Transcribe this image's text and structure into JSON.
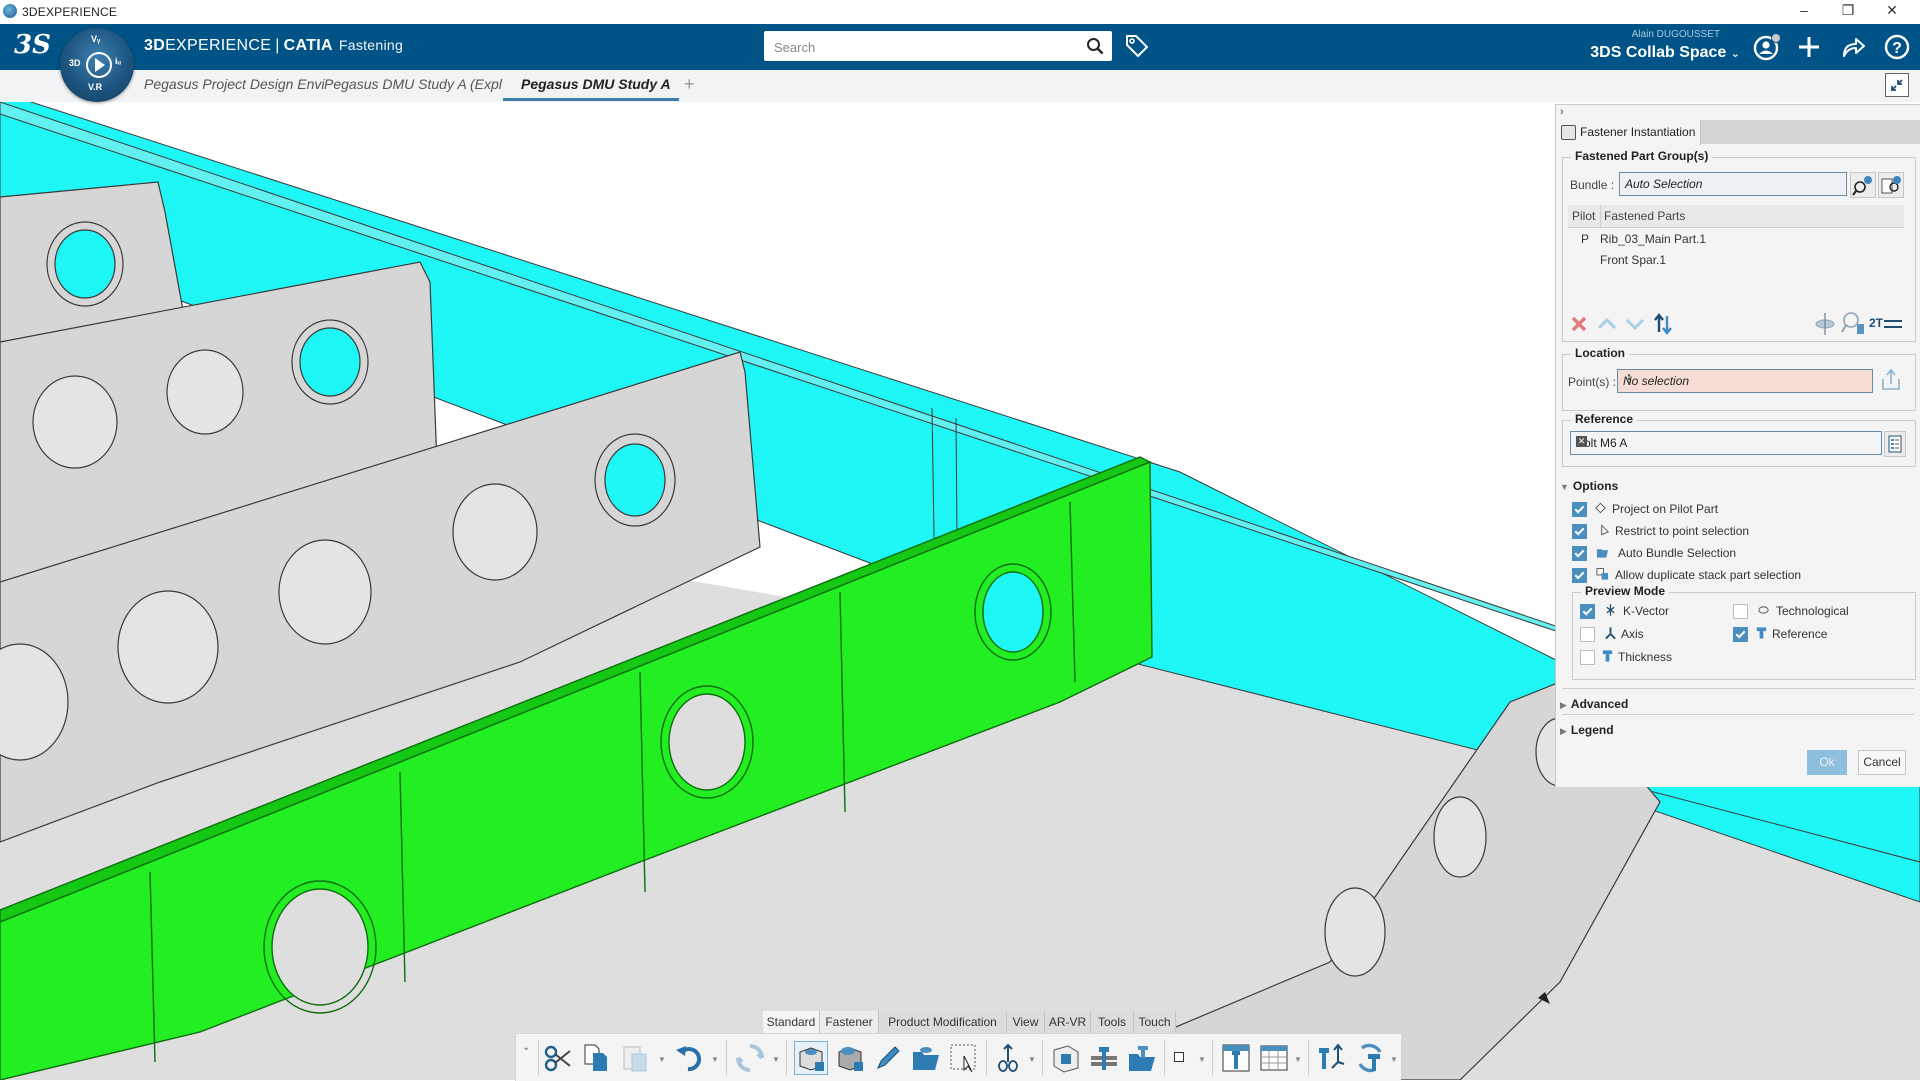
{
  "window": {
    "title": "3DEXPERIENCE",
    "controls": [
      "minimize",
      "restore",
      "close"
    ]
  },
  "header": {
    "brand_bold": "3D",
    "brand_rest": "EXPERIENCE",
    "separator": "|",
    "product": "CATIA",
    "module": "Fastening",
    "compass_labels": {
      "top": "Vᵧ",
      "left": "3D",
      "right": "iᵤ",
      "bottom": "V.R"
    },
    "search_placeholder": "Search",
    "search_value": "",
    "user_name": "Alain DUGOUSSET",
    "collab_space": "3DS Collab Space",
    "icons": [
      "tag-icon",
      "user-profile-icon",
      "add-icon",
      "share-icon",
      "help-icon"
    ]
  },
  "tabs": {
    "items": [
      {
        "label": "Pegasus Project Design Envi",
        "active": false
      },
      {
        "label": "Pegasus DMU Study A (Expl",
        "active": false
      },
      {
        "label": "Pegasus DMU Study A",
        "active": true
      }
    ],
    "add_label": "+"
  },
  "viewport": {
    "colors": {
      "background": "#ffffff",
      "spar_cyan": "#1ff6f6",
      "spar_cyan_edge": "#63f0f0",
      "selected_rib_green": "#22ee22",
      "selected_rib_dark": "#14c814",
      "rib_grey": "#d6d6d6",
      "floor_grey": "#dedede",
      "outline": "#3a3a3a"
    }
  },
  "panel": {
    "tab_title": "Fastener Instantiation",
    "fastened_group": {
      "title": "Fastened Part Group(s)",
      "bundle_label": "Bundle :",
      "bundle_value": "Auto Selection",
      "table_headers": [
        "Pilot",
        "Fastened Parts"
      ],
      "rows": [
        {
          "pilot": "P",
          "part": "Rib_03_Main Part.1"
        },
        {
          "pilot": "",
          "part": "Front Spar.1"
        }
      ],
      "row_actions": [
        "remove-icon",
        "move-up-icon",
        "move-down-icon",
        "reorder-icon"
      ],
      "right_actions": [
        "stack-thickness-icon",
        "search-fastener-icon"
      ],
      "two_t_label": "2T"
    },
    "location": {
      "title": "Location",
      "points_label": "Point(s) :",
      "points_value": "No selection"
    },
    "reference": {
      "title": "Reference",
      "value": "Bolt M6 A"
    },
    "options": {
      "title": "Options",
      "expanded": true,
      "items": [
        {
          "label": "Project on Pilot Part",
          "checked": true
        },
        {
          "label": "Restrict to point selection",
          "checked": true
        },
        {
          "label": "Auto Bundle Selection",
          "checked": true
        },
        {
          "label": "Allow duplicate stack part selection",
          "checked": true
        }
      ],
      "preview_mode": {
        "title": "Preview Mode",
        "items": [
          {
            "label": "K-Vector",
            "checked": true
          },
          {
            "label": "Technological",
            "checked": false
          },
          {
            "label": "Axis",
            "checked": false
          },
          {
            "label": "Reference",
            "checked": true
          },
          {
            "label": "Thickness",
            "checked": false
          }
        ]
      }
    },
    "advanced": {
      "title": "Advanced",
      "expanded": false
    },
    "legend": {
      "title": "Legend",
      "expanded": false
    },
    "ok_label": "Ok",
    "cancel_label": "Cancel"
  },
  "action_bar": {
    "tabs": [
      {
        "label": "Standard",
        "active": true
      },
      {
        "label": "Fastener",
        "active": false
      },
      {
        "label": "Product Modification",
        "active": false
      },
      {
        "label": "View",
        "active": false
      },
      {
        "label": "AR-VR",
        "active": false
      },
      {
        "label": "Tools",
        "active": false
      },
      {
        "label": "Touch",
        "active": false
      }
    ],
    "tools": [
      "cut-icon",
      "copy-icon",
      "paste-icon",
      "undo-icon",
      "update-icon",
      "insert-new-product-icon",
      "insert-existing-product-icon",
      "edit-icon",
      "open-catalog-icon",
      "select-trap-icon",
      "compass-icon",
      "fastener-assembly-icon",
      "fastener-instantiation-icon",
      "fastener-catalog-icon",
      "point-icon",
      "fastener-table-icon",
      "table-icon",
      "fastener-reorient-icon",
      "fastener-update-icon"
    ]
  }
}
